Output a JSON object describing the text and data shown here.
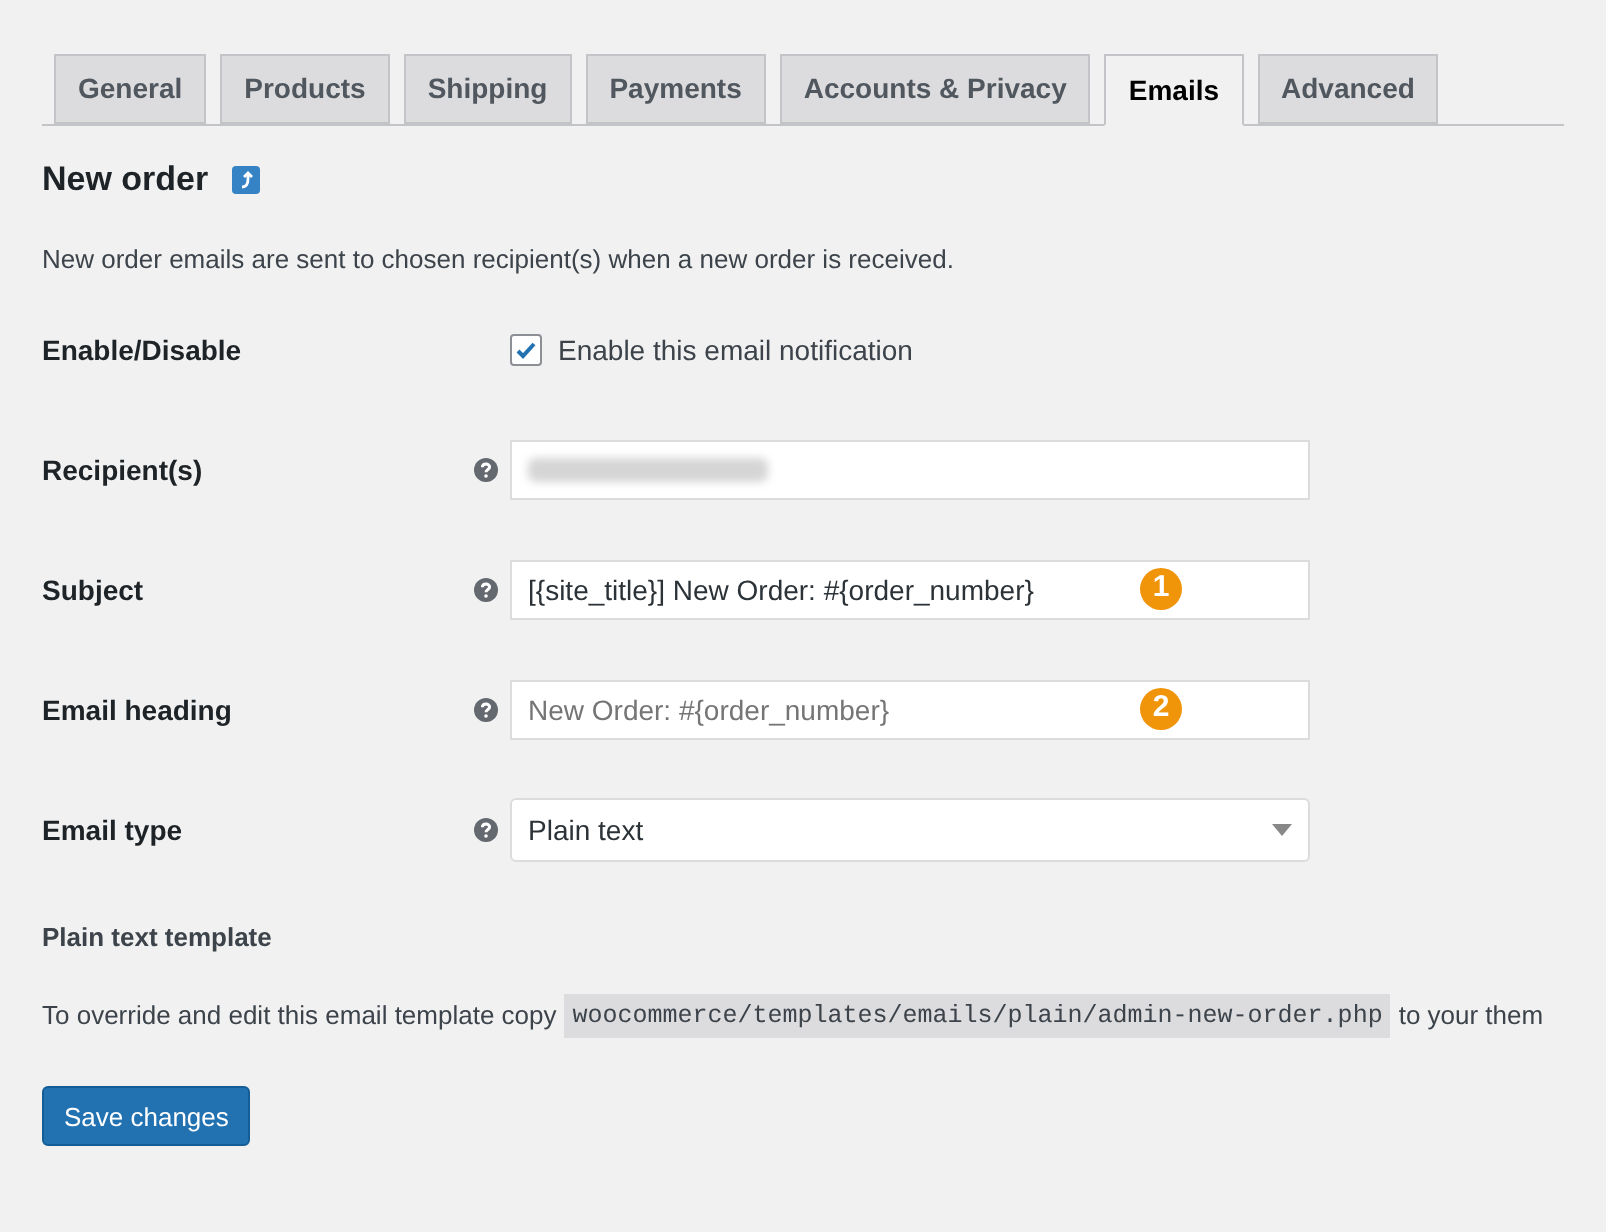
{
  "tabs": [
    {
      "label": "General",
      "selected": false
    },
    {
      "label": "Products",
      "selected": false
    },
    {
      "label": "Shipping",
      "selected": false
    },
    {
      "label": "Payments",
      "selected": false
    },
    {
      "label": "Accounts & Privacy",
      "selected": false
    },
    {
      "label": "Emails",
      "selected": true
    },
    {
      "label": "Advanced",
      "selected": false
    }
  ],
  "heading": "New order",
  "description": "New order emails are sent to chosen recipient(s) when a new order is received.",
  "fields": [
    {
      "kind": "checkbox",
      "label": "Enable/Disable",
      "text": "Enable this email notification",
      "checked": true
    },
    {
      "kind": "blurred",
      "label": "Recipient(s)"
    },
    {
      "kind": "text",
      "label": "Subject",
      "value": "[{site_title}] New Order: #{order_number}",
      "badge": "1"
    },
    {
      "kind": "text",
      "label": "Email heading",
      "placeholder": "New Order: #{order_number}",
      "badge": "2"
    },
    {
      "kind": "select",
      "label": "Email type",
      "value": "Plain text"
    }
  ],
  "template": {
    "title": "Plain text template",
    "before": "To override and edit this email template copy",
    "path": "woocommerce/templates/emails/plain/admin-new-order.php",
    "after": "to your them"
  },
  "save_button": "Save changes"
}
